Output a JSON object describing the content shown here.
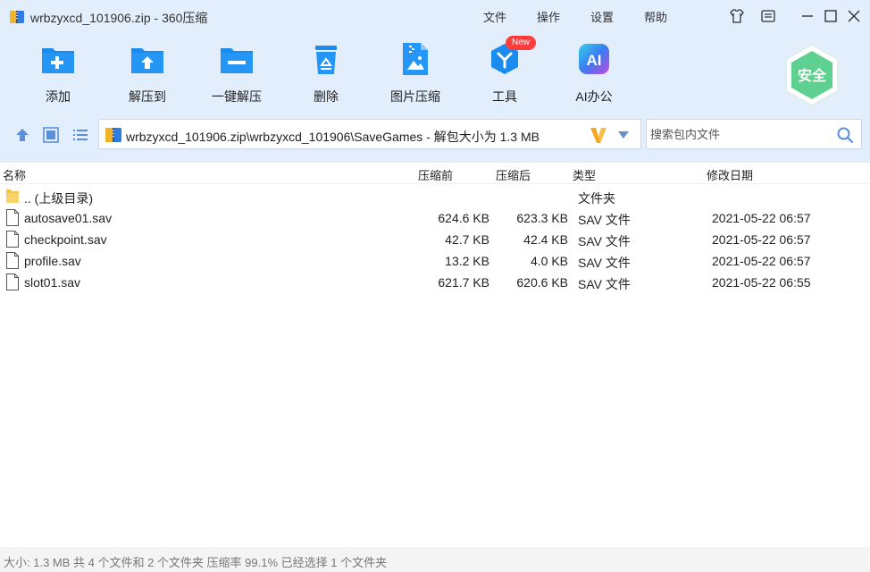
{
  "window": {
    "title": "wrbzyxcd_101906.zip - 360压缩",
    "menu": [
      "文件",
      "操作",
      "设置",
      "帮助"
    ]
  },
  "toolbar": {
    "items": [
      {
        "label": "添加",
        "icon": "add-icon"
      },
      {
        "label": "解压到",
        "icon": "extract-to-icon"
      },
      {
        "label": "一键解压",
        "icon": "one-click-extract-icon"
      },
      {
        "label": "删除",
        "icon": "delete-icon"
      },
      {
        "label": "图片压缩",
        "icon": "image-compress-icon"
      },
      {
        "label": "工具",
        "icon": "tools-icon"
      },
      {
        "label": "AI办公",
        "icon": "ai-office-icon"
      }
    ],
    "new_badge": "New",
    "ai_glyph": "AI",
    "safe_label": "安全"
  },
  "path": {
    "text": "wrbzyxcd_101906.zip\\wrbzyxcd_101906\\SaveGames - 解包大小为 1.3 MB"
  },
  "search": {
    "placeholder": "搜索包内文件"
  },
  "columns": {
    "name": "名称",
    "before": "压缩前",
    "after": "压缩后",
    "type": "类型",
    "date": "修改日期"
  },
  "files": [
    {
      "name": ".. (上级目录)",
      "before": "",
      "after": "",
      "type": "文件夹",
      "date": "",
      "kind": "folder"
    },
    {
      "name": "autosave01.sav",
      "before": "624.6 KB",
      "after": "623.3 KB",
      "type": "SAV 文件",
      "date": "2021-05-22 06:57",
      "kind": "file"
    },
    {
      "name": "checkpoint.sav",
      "before": "42.7 KB",
      "after": "42.4 KB",
      "type": "SAV 文件",
      "date": "2021-05-22 06:57",
      "kind": "file"
    },
    {
      "name": "profile.sav",
      "before": "13.2 KB",
      "after": "4.0 KB",
      "type": "SAV 文件",
      "date": "2021-05-22 06:57",
      "kind": "file"
    },
    {
      "name": "slot01.sav",
      "before": "621.7 KB",
      "after": "620.6 KB",
      "type": "SAV 文件",
      "date": "2021-05-22 06:55",
      "kind": "file"
    }
  ],
  "status": "大小: 1.3 MB 共 4 个文件和 2 个文件夹 压缩率 99.1% 已经选择 1 个文件夹",
  "colors": {
    "toolbar_bg": "#e3eefc",
    "icon_blue": "#1a8cf0",
    "new_badge": "#ff3b3b",
    "safe_green": "#3cc47a",
    "path_v": "#f5a623"
  }
}
